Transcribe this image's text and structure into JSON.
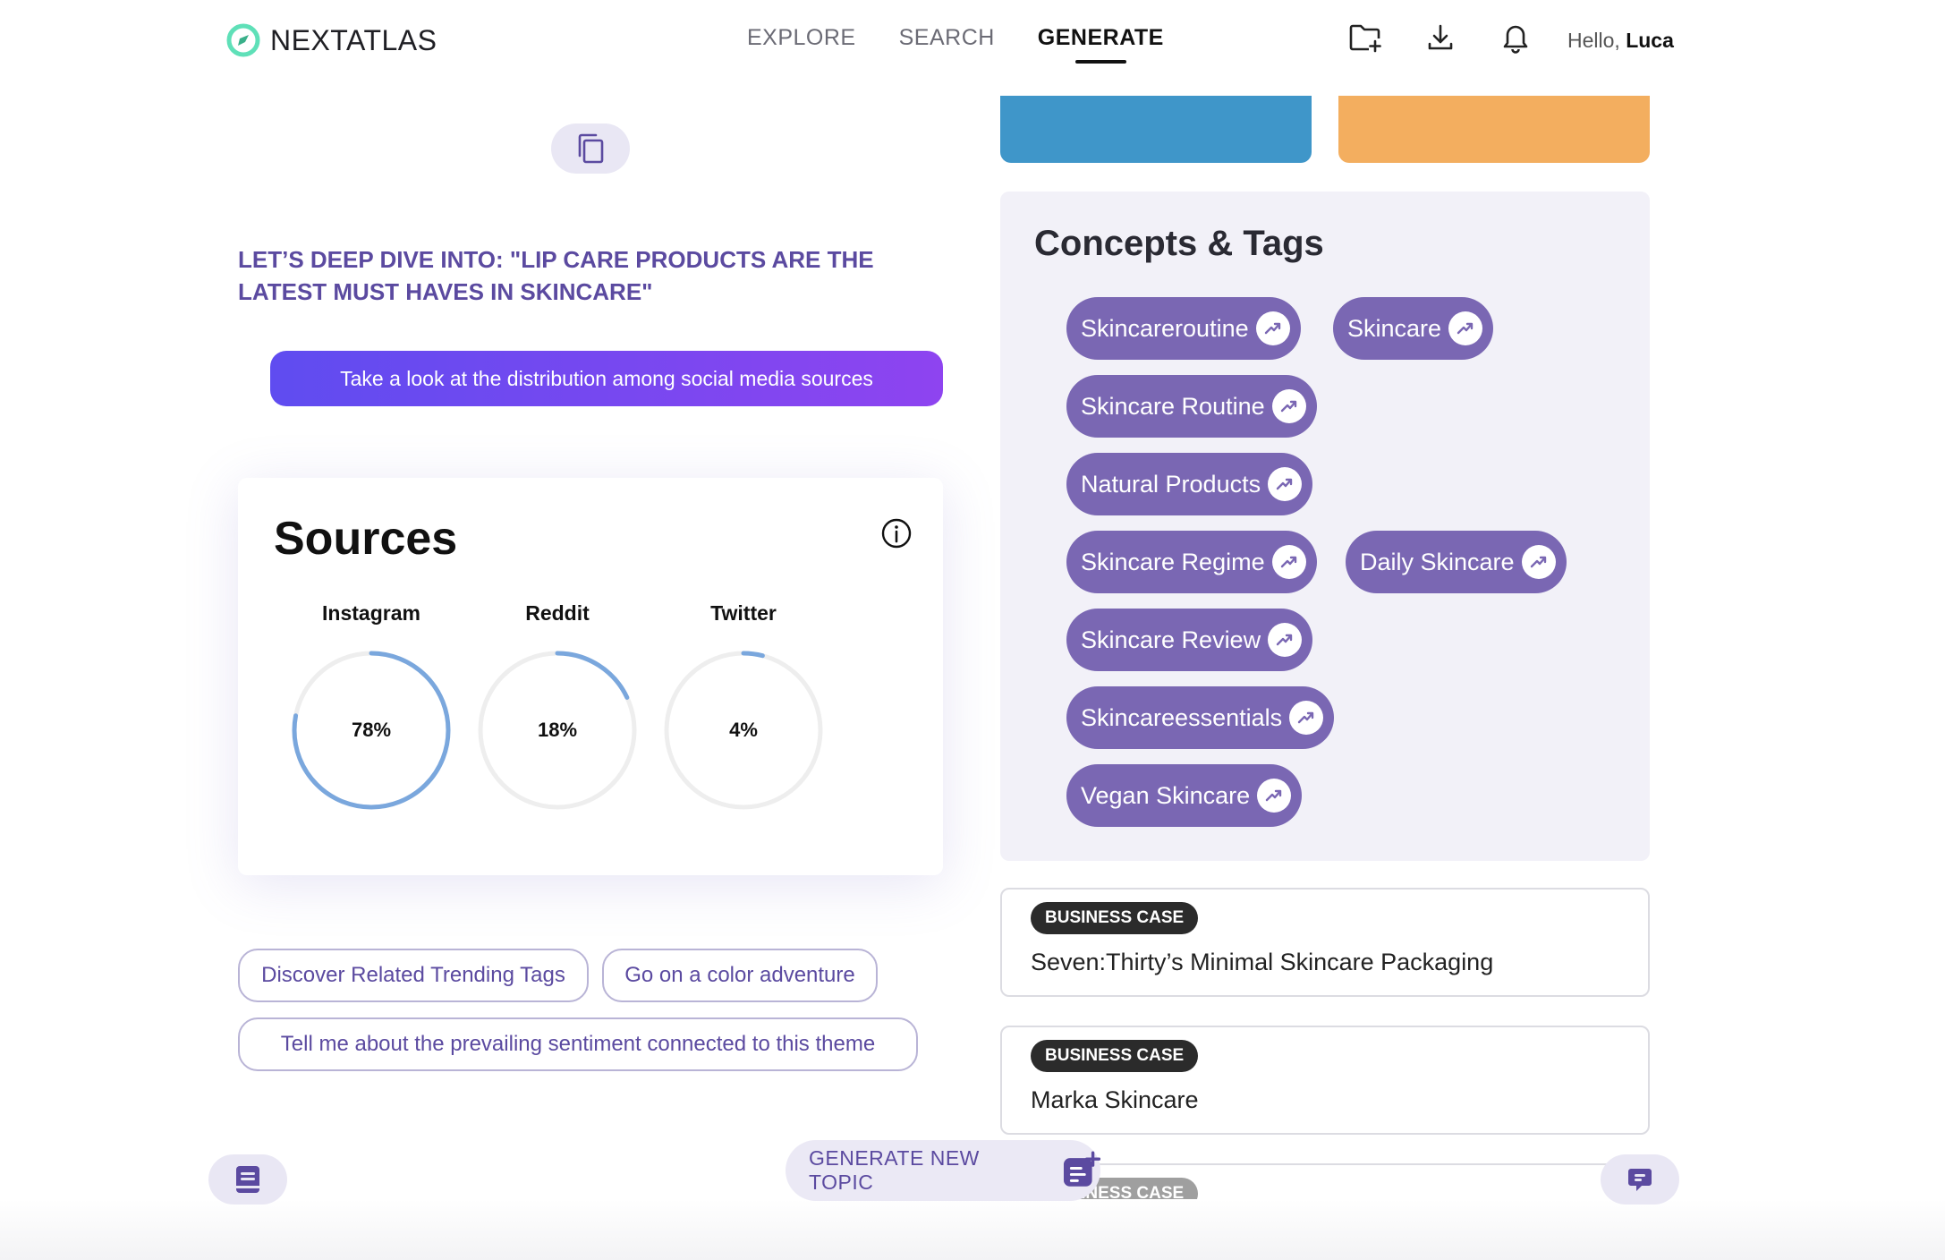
{
  "header": {
    "logo_text": "NEXTATLAS",
    "nav": [
      "EXPLORE",
      "SEARCH",
      "GENERATE"
    ],
    "active_nav": "GENERATE",
    "greeting_prefix": "Hello,",
    "user_name": "Luca",
    "icons": [
      "folder-add-icon",
      "download-icon",
      "bell-icon"
    ]
  },
  "main": {
    "deep_dive": "LET’S DEEP DIVE INTO: \"LIP CARE PRODUCTS ARE THE LATEST MUST HAVES IN SKINCARE\"",
    "distribution_button": "Take a look at the distribution among social media sources",
    "sources": {
      "title": "Sources",
      "items": [
        {
          "label": "Instagram",
          "value_text": "78%",
          "percent": 78
        },
        {
          "label": "Reddit",
          "value_text": "18%",
          "percent": 18
        },
        {
          "label": "Twitter",
          "value_text": "4%",
          "percent": 4
        }
      ]
    },
    "suggestions": [
      "Discover Related Trending Tags",
      "Go on a color adventure",
      "Tell me about the prevailing sentiment connected to this theme"
    ]
  },
  "right": {
    "swatches": [
      "#3f96c9",
      "#f3ae5f"
    ],
    "concepts_title": "Concepts & Tags",
    "tags": [
      "Skincareroutine",
      "Skincare",
      "Skincare Routine",
      "Natural Products",
      "Skincare Regime",
      "Daily Skincare",
      "Skincare Review",
      "Skincareessentials",
      "Vegan Skincare"
    ],
    "business_cases": [
      {
        "badge": "BUSINESS CASE",
        "title": "Seven:Thirty’s Minimal Skincare Packaging"
      },
      {
        "badge": "BUSINESS CASE",
        "title": "Marka Skincare"
      },
      {
        "badge": "BUSINESS CASE",
        "title": ""
      }
    ]
  },
  "bottom": {
    "generate_label": "GENERATE NEW TOPIC"
  },
  "colors": {
    "accent": "#5b4aa0",
    "tag_bg": "#7a67b3",
    "gauge_stroke": "#7aa7dd",
    "gauge_track": "#eeeeee",
    "gradient_start": "#5f4cf0",
    "gradient_end": "#8e44f0"
  }
}
